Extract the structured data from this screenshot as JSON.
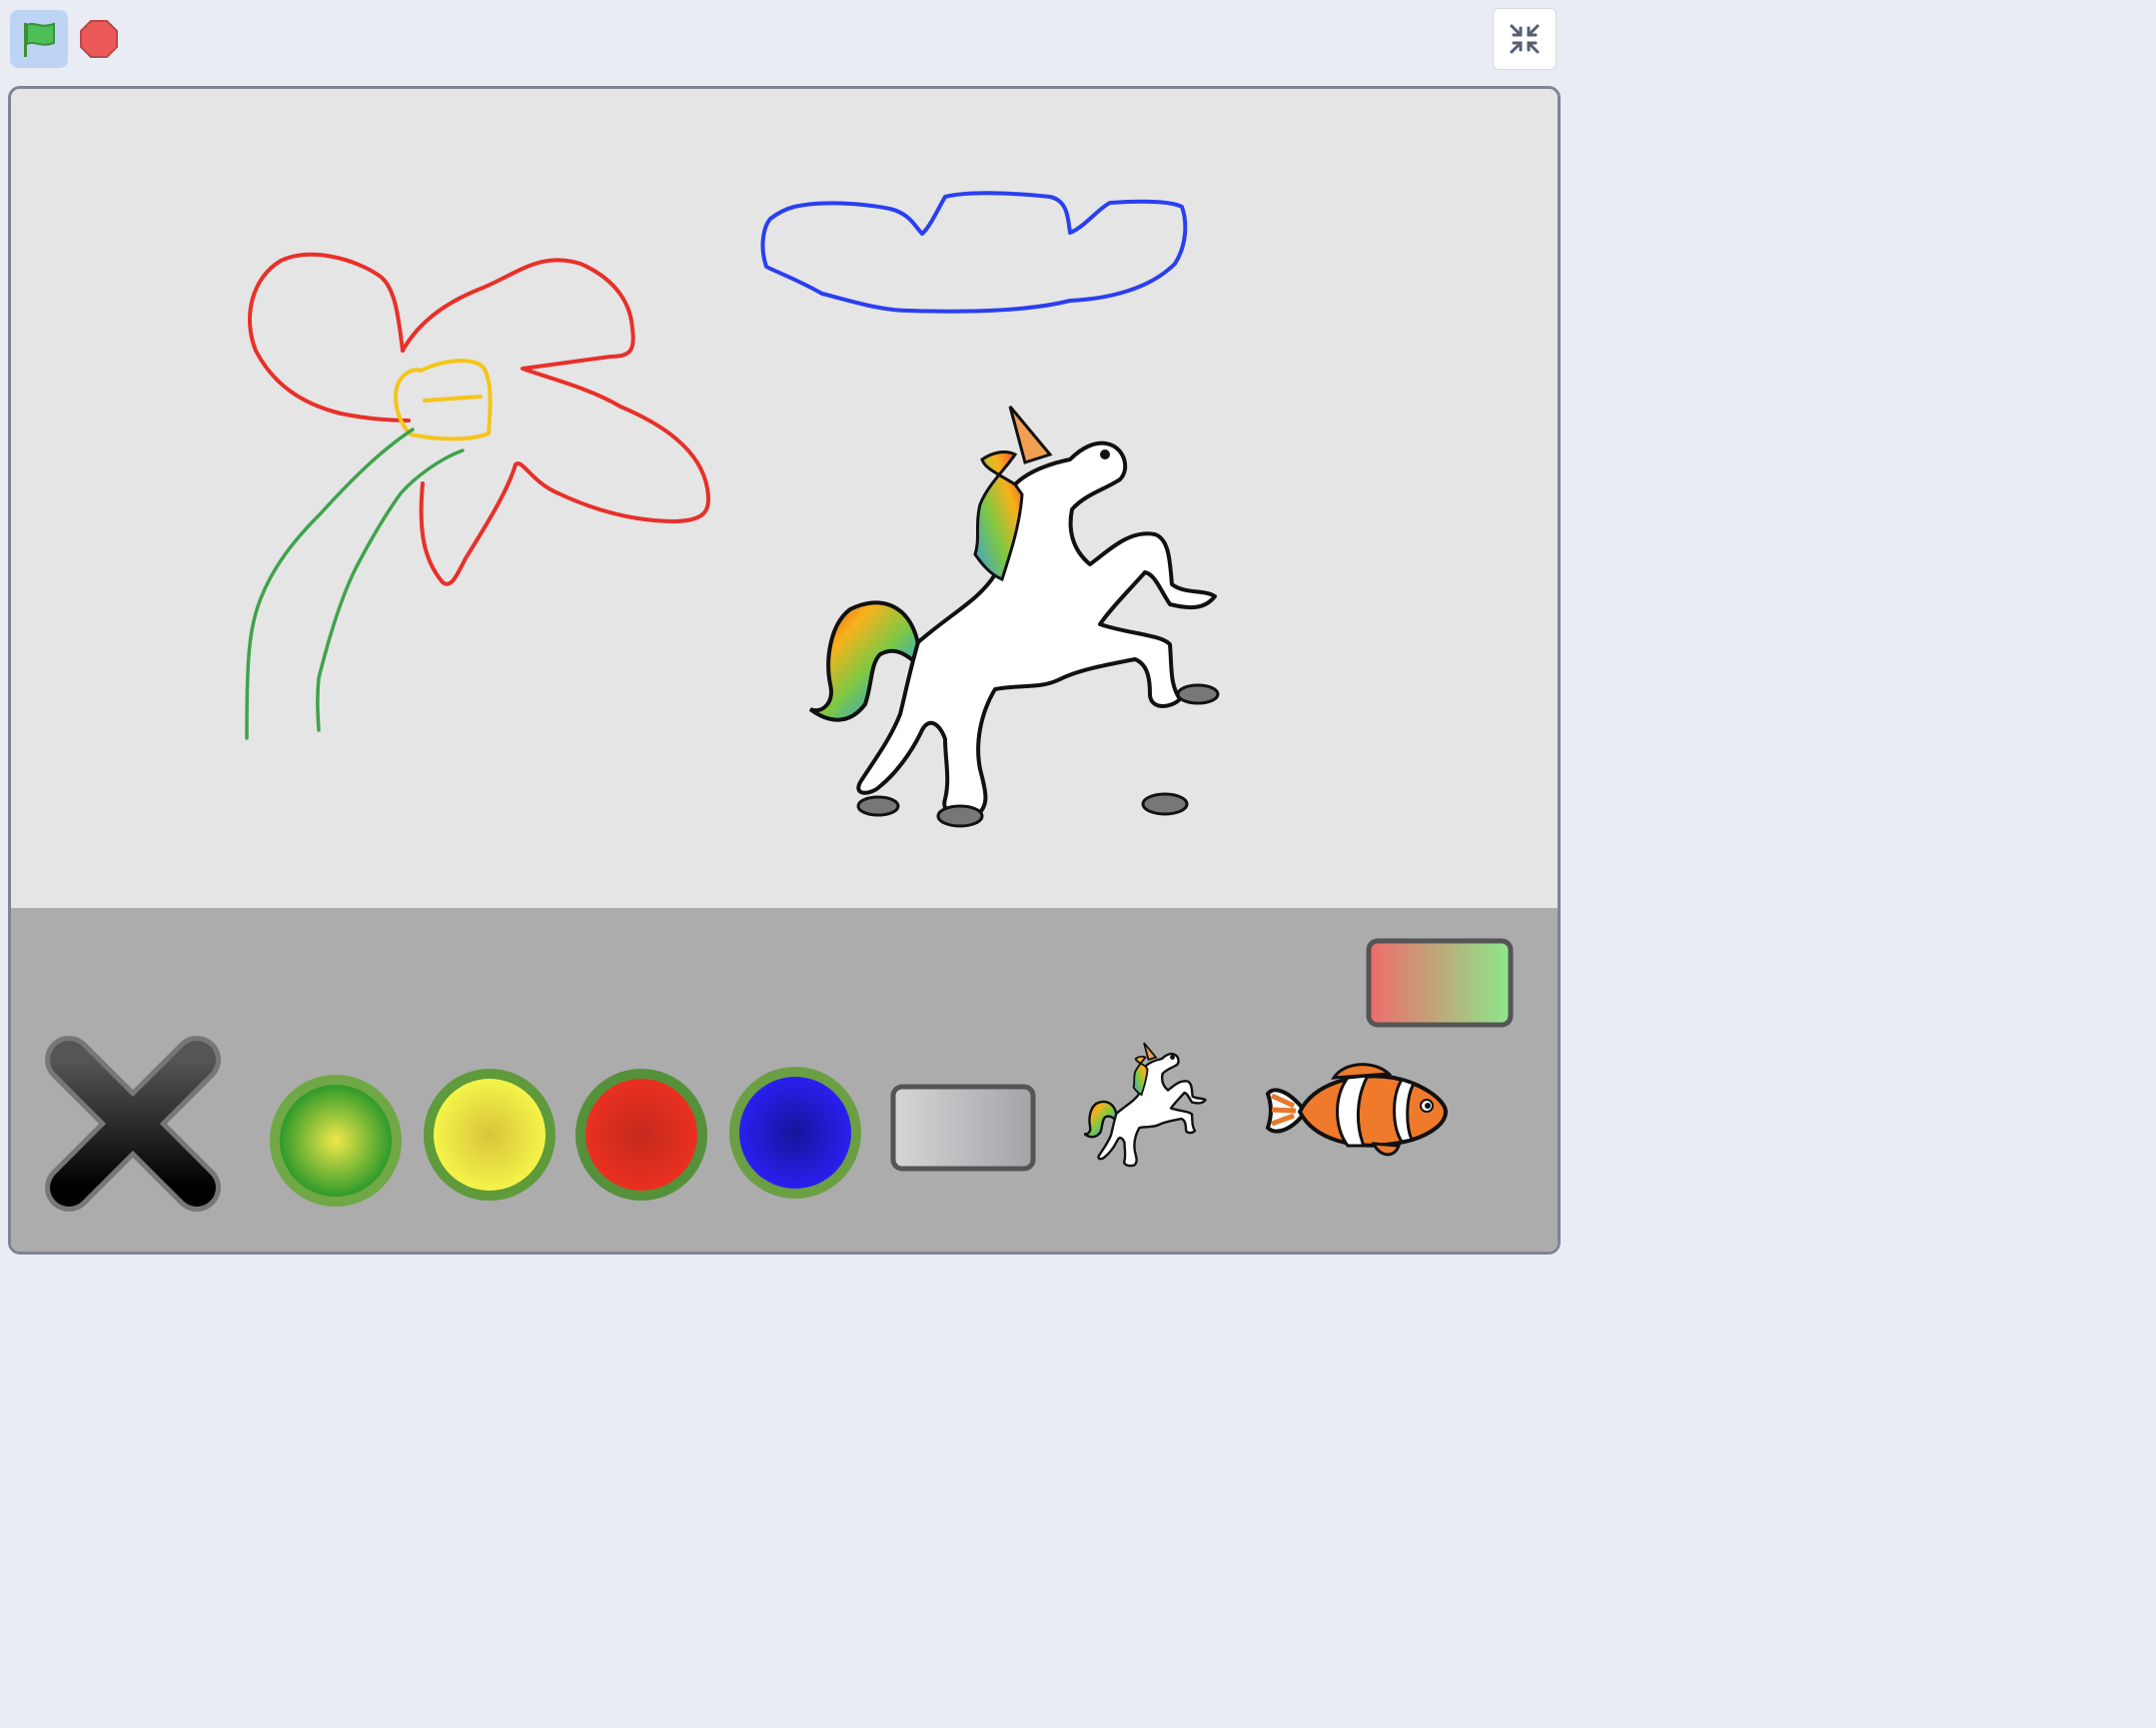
{
  "toolbar": {
    "green_flag": "green-flag-icon",
    "stop": "stop-icon",
    "fullscreen_exit": "unfullscreen-icon"
  },
  "stage": {
    "drawing": {
      "strokes": [
        {
          "name": "flower-petals",
          "color": "#e8302a"
        },
        {
          "name": "flower-center",
          "color": "#f5c518"
        },
        {
          "name": "flower-stems",
          "color": "#3fa34d"
        },
        {
          "name": "cloud",
          "color": "#2a3ff0"
        }
      ],
      "sprite": "unicorn"
    },
    "palette": {
      "tools": [
        {
          "name": "clear-all",
          "icon": "x-icon"
        },
        {
          "name": "green-pen",
          "color": "#3cae2e"
        },
        {
          "name": "yellow-pen",
          "color": "#f2ef32"
        },
        {
          "name": "red-pen",
          "color": "#e32b1c"
        },
        {
          "name": "blue-pen",
          "color": "#2a1ff0"
        },
        {
          "name": "eraser",
          "color": "#c9cacc"
        }
      ],
      "sprite_choices": [
        "unicorn",
        "clownfish"
      ],
      "color_gradient_toggle": [
        "#ef6b6b",
        "#8be98b"
      ]
    }
  }
}
